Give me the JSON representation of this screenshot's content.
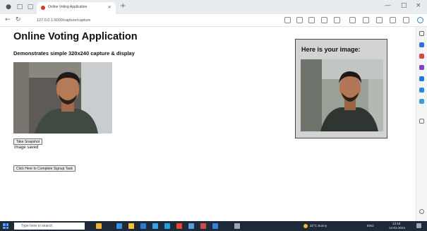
{
  "tab": {
    "title": "Online Voting Application",
    "close": "×",
    "new": "+"
  },
  "address": {
    "url": "127.0.0.1:5000/capture/capture"
  },
  "window": {
    "minimize": "—",
    "maximize": "□",
    "close": "×"
  },
  "page": {
    "title": "Online Voting Application",
    "subtitle": "Demonstrates simple 320x240 capture & display",
    "snapshot_button": "Take Snapshot",
    "status": "Image saved",
    "signup_button": "Click Here to Complete Signup Task",
    "result_title": "Here is your image:"
  },
  "taskbar": {
    "search_placeholder": "Type here to search",
    "weather": "32°C Sunny",
    "lang": "ENG",
    "time": "13:18",
    "date": "14-01-2024"
  },
  "colors": {
    "accent": "#d23a2a",
    "taskbar": "#1f2a38",
    "result_box": "#d3d3d3",
    "start": "#4fa3ff"
  },
  "icons": [
    "back-icon",
    "refresh-icon",
    "home-icon",
    "favorites-icon",
    "collections-icon",
    "extensions-icon",
    "profile-icon",
    "settings-icon",
    "copilot-icon"
  ]
}
